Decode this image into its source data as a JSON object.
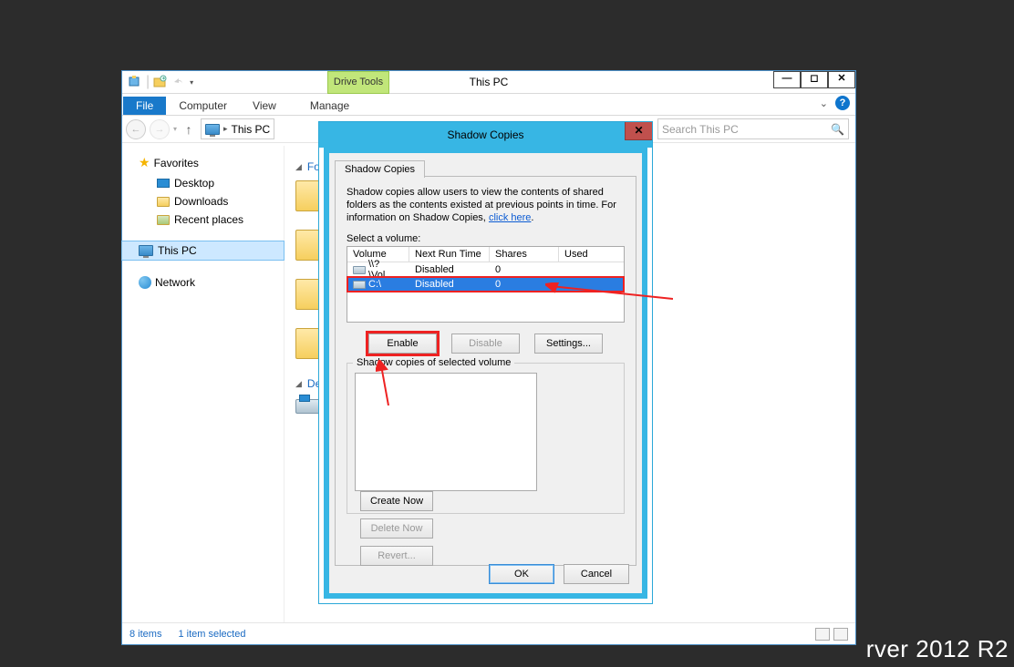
{
  "watermark": "rver 2012 R2",
  "explorer": {
    "title": "This PC",
    "context_tab": "Drive Tools",
    "ribbon_tabs": {
      "file": "File",
      "computer": "Computer",
      "view": "View",
      "manage": "Manage"
    },
    "breadcrumb": "This PC",
    "search_placeholder": "Search This PC",
    "nav": {
      "favorites": "Favorites",
      "desktop": "Desktop",
      "downloads": "Downloads",
      "recent": "Recent places",
      "this_pc": "This PC",
      "network": "Network"
    },
    "content": {
      "group_folders_prefix": "Fo",
      "group_devices_prefix": "De"
    },
    "status": {
      "count": "8 items",
      "selected": "1 item selected"
    }
  },
  "dialog": {
    "title": "Shadow Copies",
    "tab": "Shadow Copies",
    "description_1": "Shadow copies allow users to view the contents of shared folders as the contents existed at previous points in time. For information on Shadow Copies, ",
    "description_link": "click here",
    "description_2": ".",
    "select_label": "Select a volume:",
    "columns": {
      "volume": "Volume",
      "next": "Next Run Time",
      "shares": "Shares",
      "used": "Used"
    },
    "rows": [
      {
        "volume": "\\\\?\\Vol...",
        "next": "Disabled",
        "shares": "0",
        "used": ""
      },
      {
        "volume": "C:\\",
        "next": "Disabled",
        "shares": "0",
        "used": ""
      }
    ],
    "buttons": {
      "enable": "Enable",
      "disable": "Disable",
      "settings": "Settings..."
    },
    "groupbox_label": "Shadow copies of selected volume",
    "side_buttons": {
      "create": "Create Now",
      "delete": "Delete Now",
      "revert": "Revert..."
    },
    "ok": "OK",
    "cancel": "Cancel"
  }
}
